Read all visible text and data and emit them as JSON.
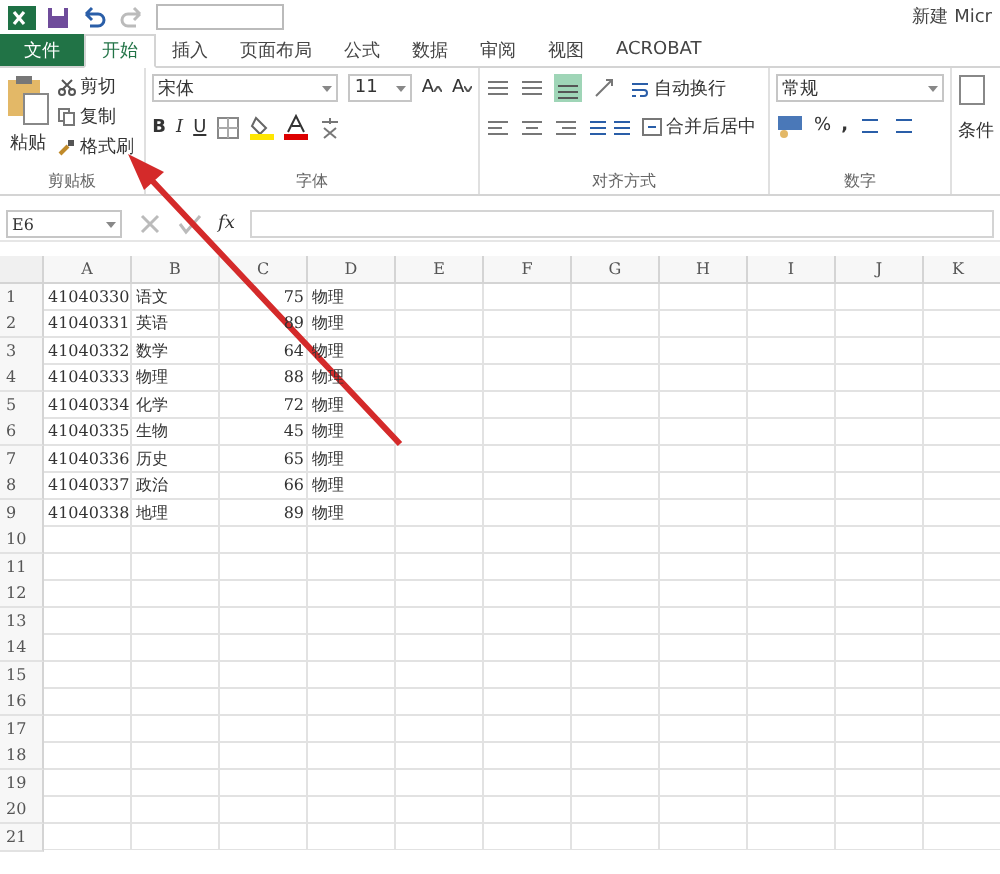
{
  "window": {
    "title": "新建 Micr"
  },
  "tabs": [
    {
      "label": "文件",
      "kind": "file",
      "selected": false
    },
    {
      "label": "开始",
      "kind": "tab",
      "selected": true
    },
    {
      "label": "插入",
      "kind": "tab",
      "selected": false
    },
    {
      "label": "页面布局",
      "kind": "tab",
      "selected": false
    },
    {
      "label": "公式",
      "kind": "tab",
      "selected": false
    },
    {
      "label": "数据",
      "kind": "tab",
      "selected": false
    },
    {
      "label": "审阅",
      "kind": "tab",
      "selected": false
    },
    {
      "label": "视图",
      "kind": "tab",
      "selected": false
    },
    {
      "label": "ACROBAT",
      "kind": "tab",
      "selected": false
    }
  ],
  "ribbon": {
    "clipboard": {
      "paste": "粘贴",
      "cut": "剪切",
      "copy": "复制",
      "format_painter": "格式刷",
      "label": "剪贴板"
    },
    "font": {
      "name": "宋体",
      "size": "11",
      "label": "字体",
      "bold": "B",
      "italic": "I",
      "underline": "U",
      "grow": "A",
      "shrink": "A"
    },
    "alignment": {
      "wrap": "自动换行",
      "merge": "合并后居中",
      "label": "对齐方式"
    },
    "number": {
      "format": "常规",
      "percent": "%",
      "comma": ",",
      "label": "数字"
    },
    "styles": {
      "conditional": "条件"
    }
  },
  "formula_bar": {
    "name_box": "E6",
    "fx": "fx"
  },
  "sheet": {
    "columns": [
      "A",
      "B",
      "C",
      "D",
      "E",
      "F",
      "G",
      "H",
      "I",
      "J",
      "K"
    ],
    "rows": [
      {
        "number": "1",
        "cells": [
          "41040330",
          "语文",
          "75",
          "物理"
        ]
      },
      {
        "number": "2",
        "cells": [
          "41040331",
          "英语",
          "89",
          "物理"
        ]
      },
      {
        "number": "3",
        "cells": [
          "41040332",
          "数学",
          "64",
          "物理"
        ]
      },
      {
        "number": "4",
        "cells": [
          "41040333",
          "物理",
          "88",
          "物理"
        ]
      },
      {
        "number": "5",
        "cells": [
          "41040334",
          "化学",
          "72",
          "物理"
        ]
      },
      {
        "number": "6",
        "cells": [
          "41040335",
          "生物",
          "45",
          "物理"
        ]
      },
      {
        "number": "7",
        "cells": [
          "41040336",
          "历史",
          "65",
          "物理"
        ]
      },
      {
        "number": "8",
        "cells": [
          "41040337",
          "政治",
          "66",
          "物理"
        ]
      },
      {
        "number": "9",
        "cells": [
          "41040338",
          "地理",
          "89",
          "物理"
        ]
      },
      {
        "number": "10",
        "cells": []
      },
      {
        "number": "11",
        "cells": []
      },
      {
        "number": "12",
        "cells": []
      },
      {
        "number": "13",
        "cells": []
      },
      {
        "number": "14",
        "cells": []
      },
      {
        "number": "15",
        "cells": []
      },
      {
        "number": "16",
        "cells": []
      },
      {
        "number": "17",
        "cells": []
      },
      {
        "number": "18",
        "cells": []
      },
      {
        "number": "19",
        "cells": []
      },
      {
        "number": "20",
        "cells": []
      },
      {
        "number": "21",
        "cells": []
      }
    ]
  }
}
